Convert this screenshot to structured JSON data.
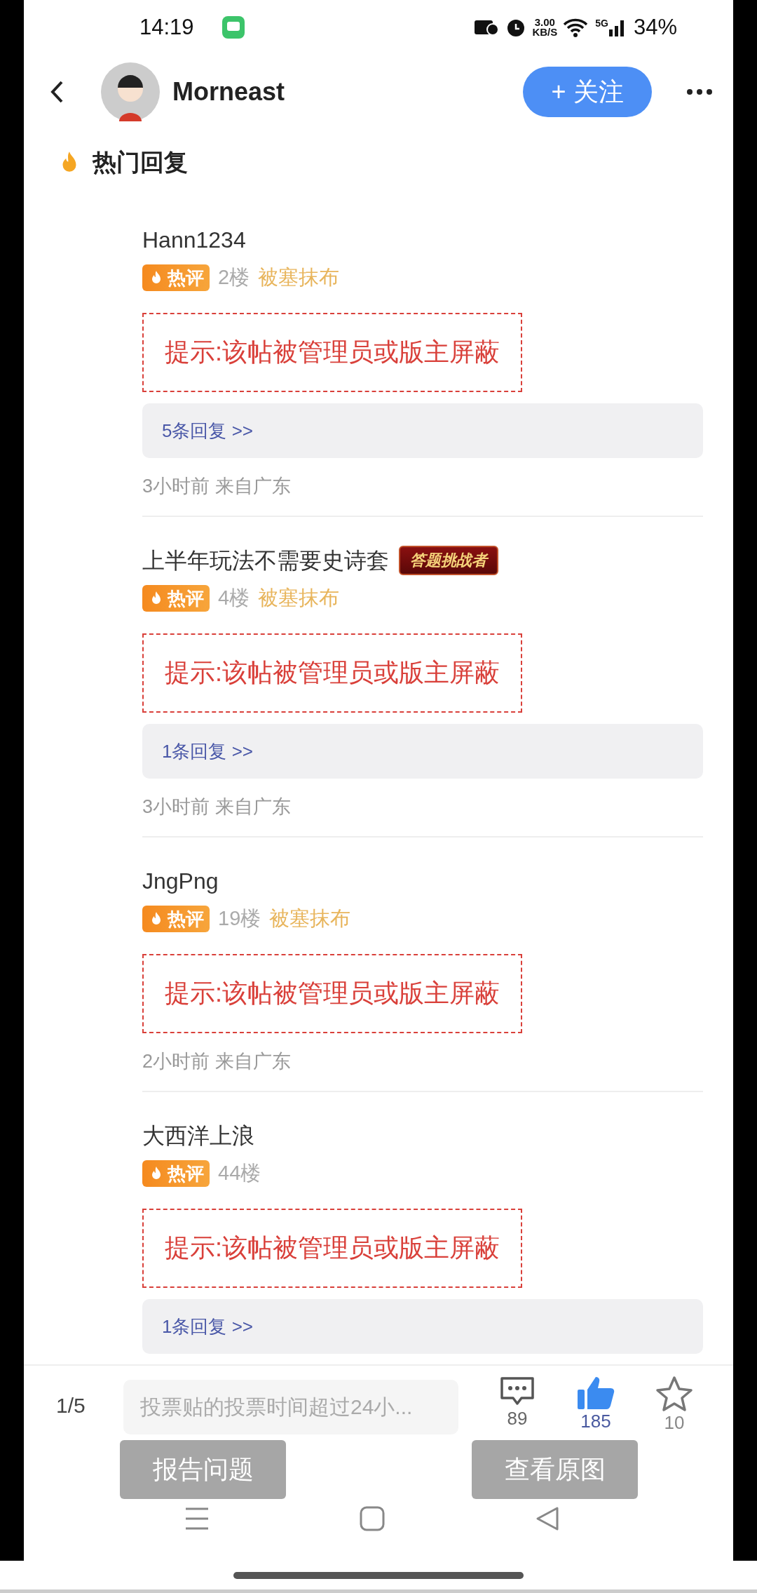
{
  "status_bar": {
    "time": "14:19",
    "speed": "3.00",
    "speed_unit": "KB/S",
    "network": "5G",
    "battery": "34%"
  },
  "header": {
    "user_name": "Morneast",
    "follow_button": "+ 关注"
  },
  "section_title": "热门回复",
  "comments": [
    {
      "user": "Hann1234",
      "tag": "热评",
      "floor": "2楼",
      "subtitle": "被塞抹布",
      "notice": "提示:该帖被管理员或版主屏蔽",
      "replies": "5条回复 >>",
      "meta": "3小时前 来自广东"
    },
    {
      "user": "上半年玩法不需要史诗套",
      "badge": "答题挑战者",
      "tag": "热评",
      "floor": "4楼",
      "subtitle": "被塞抹布",
      "notice": "提示:该帖被管理员或版主屏蔽",
      "replies": "1条回复 >>",
      "meta": "3小时前 来自广东"
    },
    {
      "user": "JngPng",
      "tag": "热评",
      "floor": "19楼",
      "subtitle": "被塞抹布",
      "notice": "提示:该帖被管理员或版主屏蔽",
      "meta": "2小时前 来自广东"
    },
    {
      "user": "大西洋上浪",
      "tag": "热评",
      "floor": "44楼",
      "notice": "提示:该帖被管理员或版主屏蔽",
      "replies": "1条回复 >>"
    }
  ],
  "bottom_bar": {
    "page": "1/5",
    "placeholder": "投票贴的投票时间超过24小...",
    "comments": "89",
    "likes": "185",
    "liked": true,
    "favorites": "10"
  },
  "overlay_buttons": [
    "报告问题",
    "查看原图"
  ]
}
